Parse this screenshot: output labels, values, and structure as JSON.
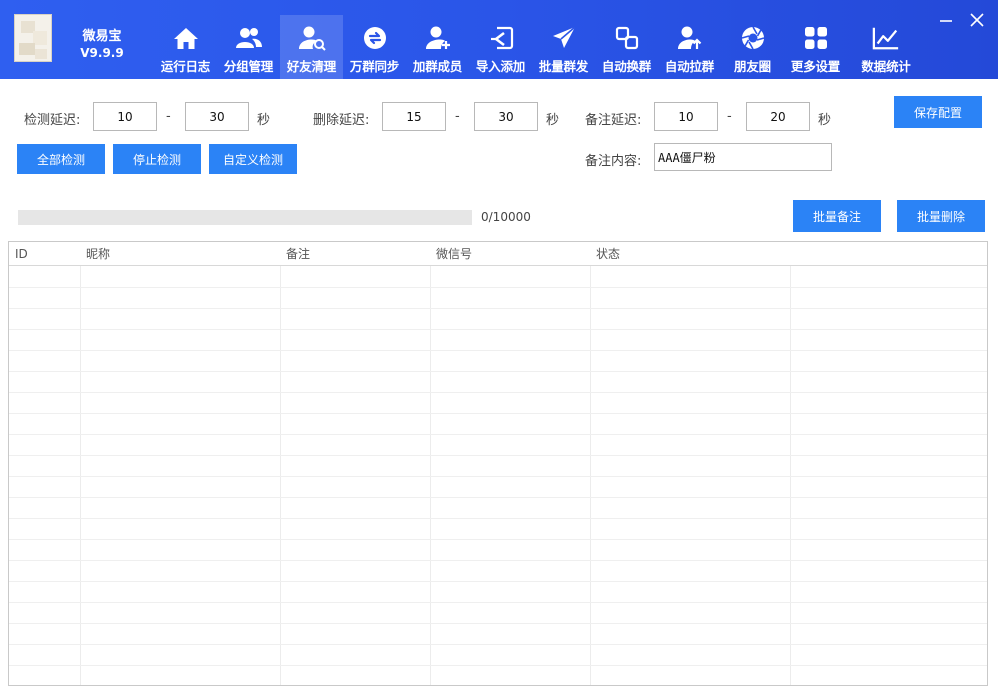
{
  "app": {
    "name": "微易宝",
    "version": "V9.9.9"
  },
  "nav": [
    {
      "label": "运行日志",
      "icon": "home-icon"
    },
    {
      "label": "分组管理",
      "icon": "users-icon"
    },
    {
      "label": "好友清理",
      "icon": "user-search-icon",
      "active": true
    },
    {
      "label": "万群同步",
      "icon": "sync-icon"
    },
    {
      "label": "加群成员",
      "icon": "user-add-icon"
    },
    {
      "label": "导入添加",
      "icon": "import-icon"
    },
    {
      "label": "批量群发",
      "icon": "send-icon"
    },
    {
      "label": "自动换群",
      "icon": "switch-icon"
    },
    {
      "label": "自动拉群",
      "icon": "user-up-icon"
    },
    {
      "label": "朋友圈",
      "icon": "aperture-icon"
    },
    {
      "label": "更多设置",
      "icon": "grid-icon"
    },
    {
      "label": "数据统计",
      "icon": "chart-icon"
    }
  ],
  "detect_delay": {
    "label": "检测延迟:",
    "min": "10",
    "max": "30",
    "unit": "秒"
  },
  "delete_delay": {
    "label": "删除延迟:",
    "min": "15",
    "max": "30",
    "unit": "秒"
  },
  "remark_delay": {
    "label": "备注延迟:",
    "min": "10",
    "max": "20",
    "unit": "秒"
  },
  "dash": "-",
  "remark_content": {
    "label": "备注内容:",
    "value": "AAA僵尸粉"
  },
  "buttons": {
    "save_config": "保存配置",
    "detect_all": "全部检测",
    "stop_detect": "停止检测",
    "custom_detect": "自定义检测",
    "batch_remark": "批量备注",
    "batch_delete": "批量删除"
  },
  "progress": {
    "text": "0/10000",
    "value": 0
  },
  "table": {
    "columns": [
      "ID",
      "昵称",
      "备注",
      "微信号",
      "状态"
    ]
  }
}
